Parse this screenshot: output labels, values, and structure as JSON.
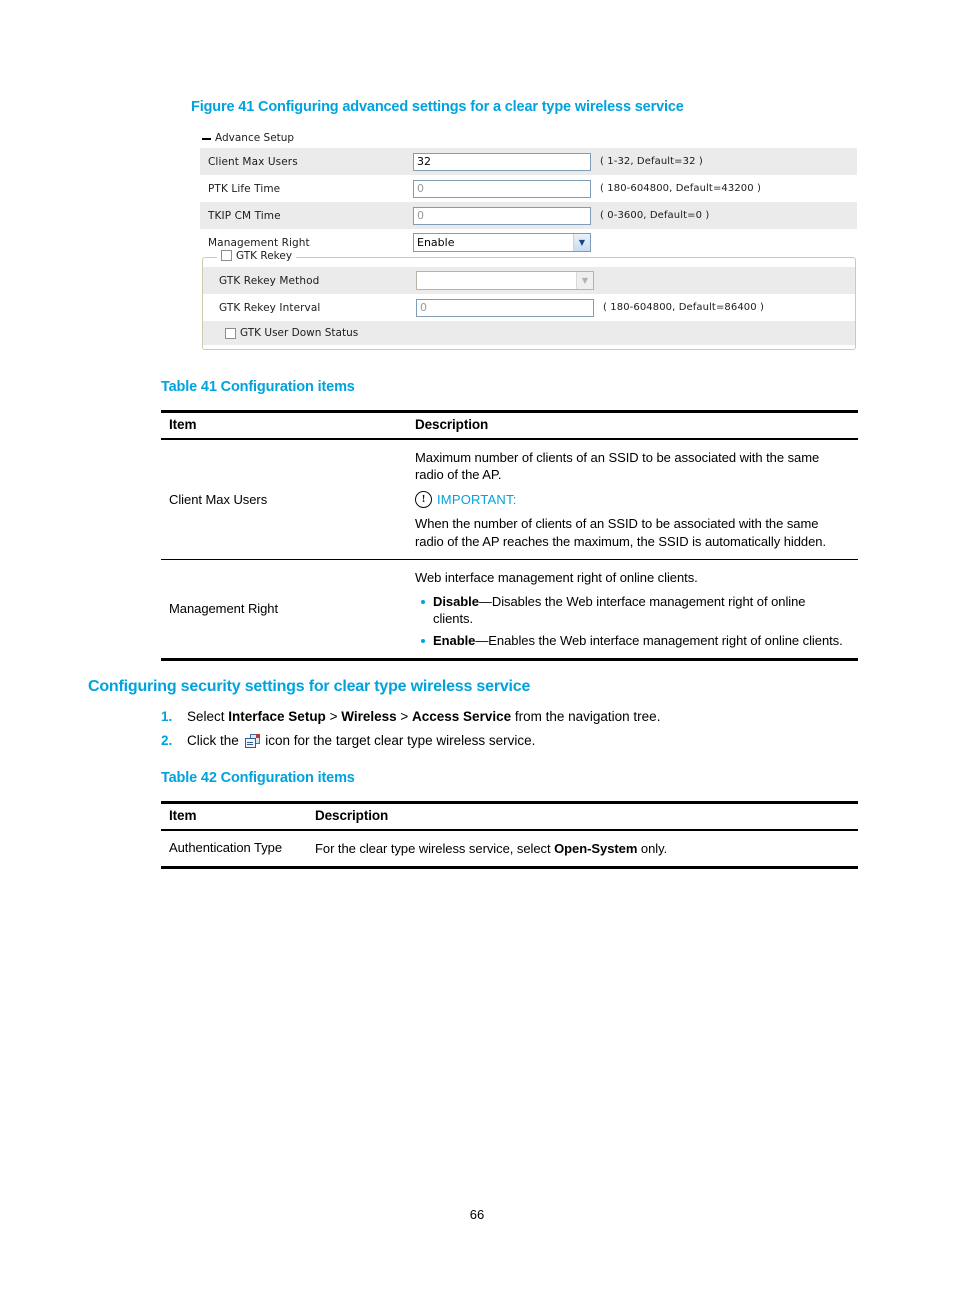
{
  "figure": {
    "caption": "Figure 41 Configuring advanced settings for a clear type wireless service",
    "screenshot": {
      "group_title": "Advance Setup",
      "rows": [
        {
          "label": "Client Max Users",
          "value": "32",
          "hint": "( 1-32, Default=32 )",
          "control": "text"
        },
        {
          "label": "PTK Life Time",
          "value": "0",
          "hint": "( 180-604800, Default=43200 )",
          "control": "text"
        },
        {
          "label": "TKIP CM Time",
          "value": "0",
          "hint": "( 0-3600, Default=0 )",
          "control": "text"
        },
        {
          "label": "Management Right",
          "value": "Enable",
          "hint": "",
          "control": "select"
        }
      ],
      "gtk_group": {
        "legend": "GTK Rekey",
        "legend_checked": false,
        "rows": [
          {
            "label": "GTK Rekey Method",
            "value": "",
            "hint": "",
            "control": "select-disabled"
          },
          {
            "label": "GTK Rekey Interval",
            "value": "0",
            "hint": "( 180-604800, Default=86400 )",
            "control": "text"
          }
        ],
        "checkbox_label": "GTK User Down Status",
        "checkbox_checked": false
      }
    }
  },
  "table41": {
    "caption": "Table 41 Configuration items",
    "headers": {
      "item": "Item",
      "description": "Description"
    },
    "rows": [
      {
        "item": "Client Max Users",
        "desc_p1": "Maximum number of clients of an SSID to be associated with the same radio of the AP.",
        "important_label": "IMPORTANT:",
        "desc_p2": "When the number of clients of an SSID to be associated with the same radio of the AP reaches the maximum, the SSID is automatically hidden."
      }
    ],
    "row2": {
      "item": "Management Right",
      "desc_p1": "Web interface management right of online clients.",
      "bullets": [
        {
          "term": "Disable",
          "rest": "—Disables the Web interface management right of online clients."
        },
        {
          "term": "Enable",
          "rest": "—Enables the Web interface management right of online clients."
        }
      ]
    }
  },
  "section": {
    "heading": "Configuring security settings for clear type wireless service",
    "steps": [
      {
        "num": "1.",
        "pre": "Select ",
        "b1": "Interface Setup",
        "sep1": " > ",
        "b2": "Wireless",
        "sep2": " > ",
        "b3": "Access Service",
        "post": " from the navigation tree."
      },
      {
        "num": "2.",
        "pre": "Click the ",
        "post": " icon for the target clear type wireless service."
      }
    ]
  },
  "table42": {
    "caption": "Table 42 Configuration items",
    "headers": {
      "item": "Item",
      "description": "Description"
    },
    "row": {
      "item": "Authentication Type",
      "desc_pre": "For the clear type wireless service, select ",
      "desc_bold": "Open-System",
      "desc_post": " only."
    }
  },
  "footer": {
    "page_number": "66"
  },
  "colors": {
    "heading_blue": "#00a3dd",
    "row_shade": "#ebebeb",
    "input_border": "#7f9db9"
  }
}
